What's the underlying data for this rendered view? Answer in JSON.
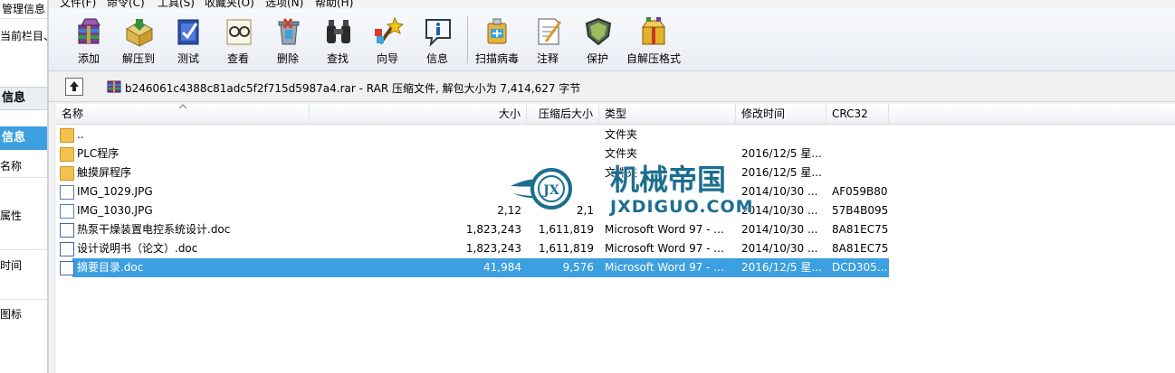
{
  "left_panel": {
    "rows": [
      {
        "text": "管理信息",
        "type": "text"
      },
      {
        "text": "当前栏目、",
        "type": "text"
      },
      {
        "text": "信息",
        "type": "head"
      },
      {
        "text": "信息",
        "type": "selected"
      },
      {
        "text": "名称",
        "type": "text"
      },
      {
        "text": "属性",
        "type": "text"
      },
      {
        "text": "时间",
        "type": "text"
      },
      {
        "text": "图标",
        "type": "text"
      }
    ]
  },
  "menu": [
    "文件(F)",
    "命令(C)",
    "工具(S)",
    "收藏夹(O)",
    "选项(N)",
    "帮助(H)"
  ],
  "toolbar": [
    {
      "label": "添加",
      "icon": "add-archive-icon"
    },
    {
      "label": "解压到",
      "icon": "extract-to-icon"
    },
    {
      "label": "测试",
      "icon": "test-icon"
    },
    {
      "label": "查看",
      "icon": "view-icon"
    },
    {
      "label": "删除",
      "icon": "delete-icon"
    },
    {
      "label": "查找",
      "icon": "find-icon"
    },
    {
      "label": "向导",
      "icon": "wizard-icon"
    },
    {
      "label": "信息",
      "icon": "info-icon"
    },
    {
      "label": "扫描病毒",
      "icon": "virus-scan-icon"
    },
    {
      "label": "注释",
      "icon": "comment-icon"
    },
    {
      "label": "保护",
      "icon": "protect-icon"
    },
    {
      "label": "自解压格式",
      "icon": "sfx-icon"
    }
  ],
  "address": {
    "path": "b246061c4388c81adc5f2f715d5987a4.rar - RAR 压缩文件, 解包大小为 7,414,627 字节"
  },
  "columns": {
    "name": "名称",
    "size": "大小",
    "packed": "压缩后大小",
    "type": "类型",
    "modified": "修改时间",
    "crc": "CRC32"
  },
  "files": [
    {
      "name": "..",
      "size": "",
      "packed": "",
      "type": "文件夹",
      "modified": "",
      "crc": "",
      "icon": "folder",
      "selected": false
    },
    {
      "name": "PLC程序",
      "size": "",
      "packed": "",
      "type": "文件夹",
      "modified": "2016/12/5 星...",
      "crc": "",
      "icon": "folder",
      "selected": false
    },
    {
      "name": "触摸屏程序",
      "size": "",
      "packed": "",
      "type": "文件夹",
      "modified": "2016/12/5 星...",
      "crc": "",
      "icon": "folder",
      "selected": false
    },
    {
      "name": "IMG_1029.JPG",
      "size": "",
      "packed": "",
      "type": "",
      "modified": "2014/10/30 ...",
      "crc": "AF059B80",
      "icon": "jpg",
      "selected": false
    },
    {
      "name": "IMG_1030.JPG",
      "size": "2,12",
      "packed": "2,1",
      "type": "",
      "modified": "2014/10/30 ...",
      "crc": "57B4B095",
      "icon": "jpg",
      "selected": false
    },
    {
      "name": "热泵干燥装置电控系统设计.doc",
      "size": "1,823,243",
      "packed": "1,611,819",
      "type": "Microsoft Word 97 - ...",
      "modified": "2014/10/30 ...",
      "crc": "8A81EC75",
      "icon": "doc",
      "selected": false
    },
    {
      "name": "设计说明书（论文）.doc",
      "size": "1,823,243",
      "packed": "1,611,819",
      "type": "Microsoft Word 97 - ...",
      "modified": "2014/10/30 ...",
      "crc": "8A81EC75",
      "icon": "doc",
      "selected": false
    },
    {
      "name": "摘要目录.doc",
      "size": "41,984",
      "packed": "9,576",
      "type": "Microsoft Word 97 - ...",
      "modified": "2016/12/5 星...",
      "crc": "DCD305...",
      "icon": "doc",
      "selected": true
    }
  ],
  "watermark": {
    "title": "机械帝国",
    "subtitle": "JXDIGUO.COM",
    "badge": "JX"
  },
  "colors": {
    "selection": "#3c9fe0",
    "watermark": "#1c6e8f"
  }
}
